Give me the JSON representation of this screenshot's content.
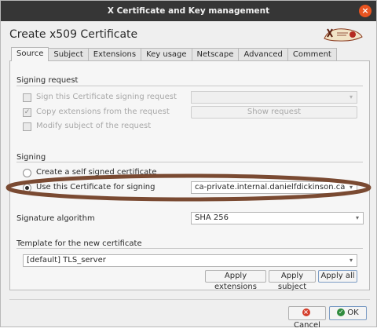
{
  "window": {
    "title": "X Certificate and Key management",
    "close_label": "×"
  },
  "heading": "Create x509 Certificate",
  "tabs": [
    {
      "label": "Source"
    },
    {
      "label": "Subject"
    },
    {
      "label": "Extensions"
    },
    {
      "label": "Key usage"
    },
    {
      "label": "Netscape"
    },
    {
      "label": "Advanced"
    },
    {
      "label": "Comment"
    }
  ],
  "signing_request": {
    "title": "Signing request",
    "sign_csr_label": "Sign this Certificate signing request",
    "copy_ext_label": "Copy extensions from the request",
    "modify_subject_label": "Modify subject of the request",
    "csr_select_value": "",
    "show_request_label": "Show request"
  },
  "signing": {
    "title": "Signing",
    "self_signed_label": "Create a self signed certificate",
    "use_cert_label": "Use this Certificate for signing",
    "ca_select_value": "ca-private.internal.danielfdickinson.ca"
  },
  "signature": {
    "label": "Signature algorithm",
    "value": "SHA 256"
  },
  "template": {
    "title": "Template for the new certificate",
    "value": "[default] TLS_server",
    "apply_extensions_label": "Apply extensions",
    "apply_subject_label": "Apply subject",
    "apply_all_label": "Apply all"
  },
  "footer": {
    "cancel_label": "Cancel",
    "ok_label": "OK"
  },
  "colors": {
    "titlebar": "#363636",
    "close_button": "#e95420",
    "annotation_ellipse": "#7a4a32"
  }
}
